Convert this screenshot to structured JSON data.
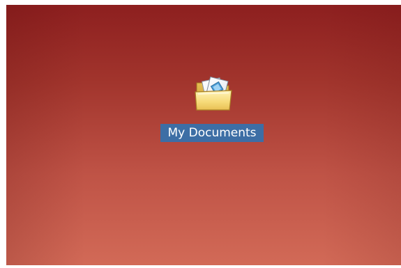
{
  "desktop": {
    "background_colors": [
      "#8d1f1f",
      "#d26a57"
    ],
    "icons": [
      {
        "label": "My Documents",
        "icon": "documents-folder-icon",
        "selected": true,
        "selection_color": "#3d6ea5"
      }
    ]
  }
}
